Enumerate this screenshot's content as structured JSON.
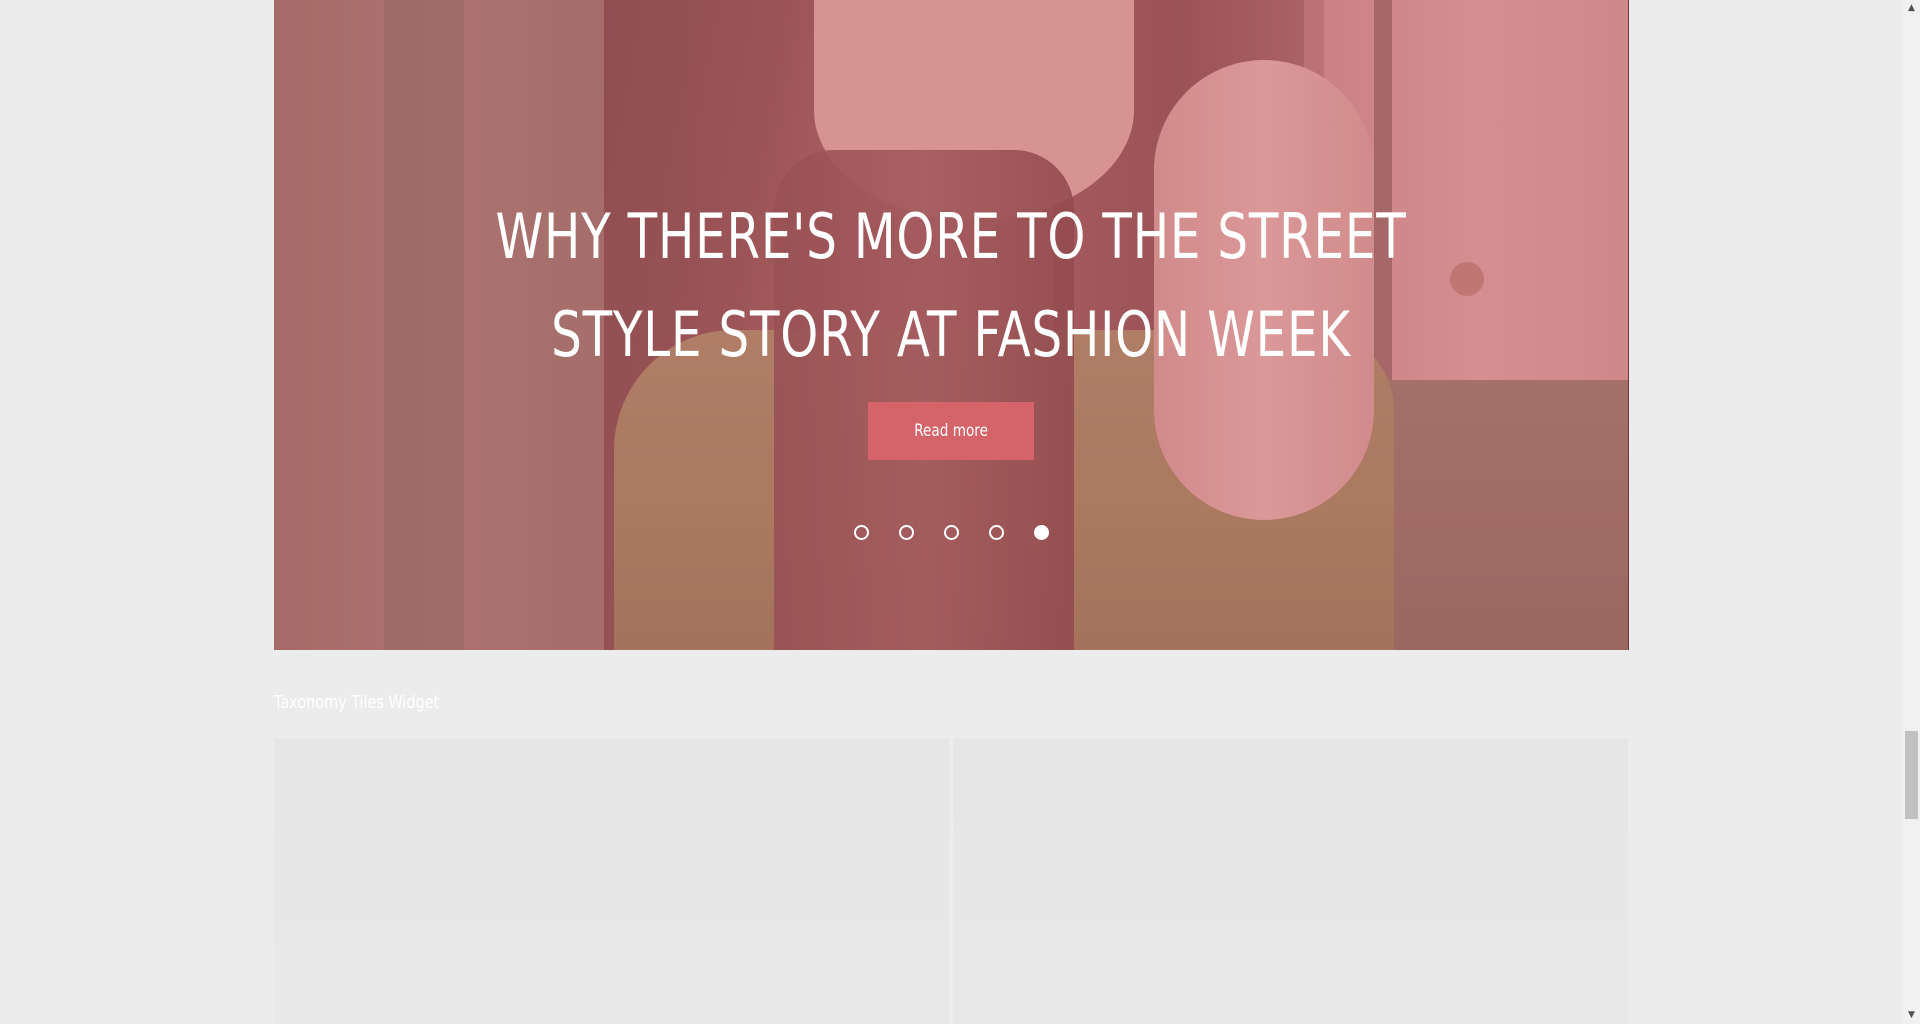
{
  "slider": {
    "title": "WHY THERE'S MORE TO THE STREET STYLE STORY AT FASHION WEEK",
    "read_more_label": "Read more",
    "dots": [
      {
        "active": false
      },
      {
        "active": false
      },
      {
        "active": false
      },
      {
        "active": false
      },
      {
        "active": true
      }
    ],
    "overlay_color": "#cd6e73",
    "button_color": "#d4636a"
  },
  "widget": {
    "title": "Taxonomy Tiles Widget",
    "tile_count": 2
  },
  "scrollbar": {
    "up_icon": "arrow-up-icon",
    "down_icon": "arrow-down-icon"
  },
  "colors": {
    "page_background": "#ececec",
    "tile_background": "#e7e7e7",
    "text_light": "#ffffff"
  }
}
